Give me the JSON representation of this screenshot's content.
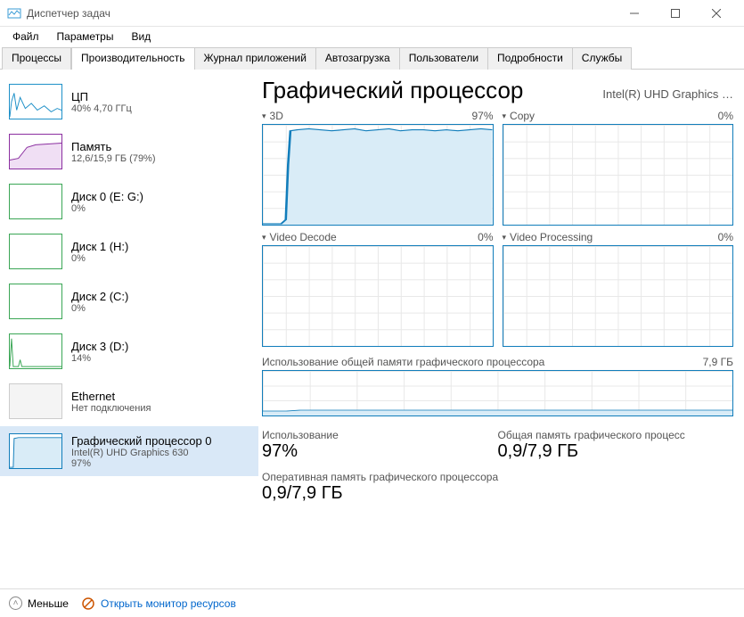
{
  "window": {
    "title": "Диспетчер задач"
  },
  "menu": {
    "file": "Файл",
    "options": "Параметры",
    "view": "Вид"
  },
  "tabs": {
    "processes": "Процессы",
    "performance": "Производительность",
    "apphistory": "Журнал приложений",
    "startup": "Автозагрузка",
    "users": "Пользователи",
    "details": "Подробности",
    "services": "Службы"
  },
  "sidebar": [
    {
      "name": "ЦП",
      "sub": "40% 4,70 ГГц",
      "color": "#1e90c8"
    },
    {
      "name": "Память",
      "sub": "12,6/15,9 ГБ (79%)",
      "color": "#8b2fa0"
    },
    {
      "name": "Диск 0 (E: G:)",
      "sub": "0%",
      "color": "#3aa655"
    },
    {
      "name": "Диск 1 (H:)",
      "sub": "0%",
      "color": "#3aa655"
    },
    {
      "name": "Диск 2 (C:)",
      "sub": "0%",
      "color": "#3aa655"
    },
    {
      "name": "Диск 3 (D:)",
      "sub": "14%",
      "color": "#3aa655"
    },
    {
      "name": "Ethernet",
      "sub": "Нет подключения",
      "color": "#888"
    },
    {
      "name": "Графический процессор 0",
      "sub": "Intel(R) UHD Graphics 630",
      "sub2": "97%",
      "color": "#117dbb"
    }
  ],
  "main": {
    "title": "Графический процессор",
    "device": "Intel(R) UHD Graphics …",
    "engines": [
      {
        "name": "3D",
        "pct": "97%"
      },
      {
        "name": "Copy",
        "pct": "0%"
      },
      {
        "name": "Video Decode",
        "pct": "0%"
      },
      {
        "name": "Video Processing",
        "pct": "0%"
      }
    ],
    "shared_label": "Использование общей памяти графического процессора",
    "shared_max": "7,9 ГБ",
    "stats": {
      "usage_label": "Использование",
      "usage_value": "97%",
      "shared_label": "Общая память графического процесс",
      "shared_value": "0,9/7,9 ГБ",
      "dedicated_label": "Оперативная память графического процессора",
      "dedicated_value": "0,9/7,9 ГБ"
    }
  },
  "footer": {
    "less": "Меньше",
    "resmon": "Открыть монитор ресурсов"
  },
  "chart_data": {
    "type": "line",
    "title": "GPU engine utilization",
    "ylim": [
      0,
      100
    ],
    "series": [
      {
        "name": "3D",
        "values": [
          0,
          0,
          0,
          0,
          0,
          2,
          5,
          3,
          2,
          60,
          95,
          96,
          97,
          95,
          96,
          97,
          94,
          96,
          95,
          93,
          97,
          96,
          95,
          97,
          96,
          95,
          94,
          96,
          97,
          95,
          97,
          95,
          96,
          95,
          96,
          97,
          95,
          96,
          95,
          94,
          96,
          97,
          95,
          94,
          96,
          97,
          95,
          96,
          97,
          96,
          97,
          95
        ]
      },
      {
        "name": "Copy",
        "values": [
          0,
          0,
          0,
          0,
          0,
          0,
          0,
          0,
          0,
          0,
          0,
          0,
          0,
          0,
          0,
          0,
          0,
          0,
          0,
          0,
          0,
          0,
          0,
          0,
          0,
          0,
          0,
          0,
          0,
          0,
          0,
          0,
          0,
          0,
          0,
          0,
          0,
          0,
          0,
          0,
          0,
          0,
          0,
          0,
          0,
          0,
          0,
          0,
          0,
          0,
          0,
          0
        ]
      },
      {
        "name": "Video Decode",
        "values": [
          0,
          0,
          0,
          0,
          0,
          0,
          0,
          0,
          0,
          0,
          0,
          0,
          0,
          0,
          0,
          0,
          0,
          0,
          0,
          0,
          0,
          0,
          0,
          0,
          0,
          0,
          0,
          0,
          0,
          0,
          0,
          0,
          0,
          0,
          0,
          0,
          0,
          0,
          0,
          0,
          0,
          0,
          0,
          0,
          0,
          0,
          0,
          0,
          0,
          0,
          0,
          0
        ]
      },
      {
        "name": "Video Processing",
        "values": [
          0,
          0,
          0,
          0,
          0,
          0,
          0,
          0,
          0,
          0,
          0,
          0,
          0,
          0,
          0,
          0,
          0,
          0,
          0,
          0,
          0,
          0,
          0,
          0,
          0,
          0,
          0,
          0,
          0,
          0,
          0,
          0,
          0,
          0,
          0,
          0,
          0,
          0,
          0,
          0,
          0,
          0,
          0,
          0,
          0,
          0,
          0,
          0,
          0,
          0,
          0,
          0
        ]
      },
      {
        "name": "Shared GPU Memory (GB)",
        "ylim": [
          0,
          7.9
        ],
        "values": [
          0.6,
          0.6,
          0.6,
          0.6,
          0.6,
          0.7,
          0.9,
          0.9,
          0.9,
          0.9,
          0.9,
          0.9,
          0.9,
          0.9,
          0.9,
          0.9,
          0.9,
          0.9,
          0.9,
          0.9,
          0.9,
          0.9,
          0.9,
          0.9,
          0.9,
          0.9,
          0.9,
          0.9,
          0.9,
          0.9,
          0.9,
          0.9,
          0.9,
          0.9,
          0.9,
          0.9,
          0.9,
          0.9,
          0.9,
          0.9,
          0.9,
          0.9,
          0.9,
          0.9,
          0.9,
          0.9,
          0.9,
          0.9,
          0.9,
          0.9,
          0.9,
          0.9
        ]
      }
    ]
  }
}
